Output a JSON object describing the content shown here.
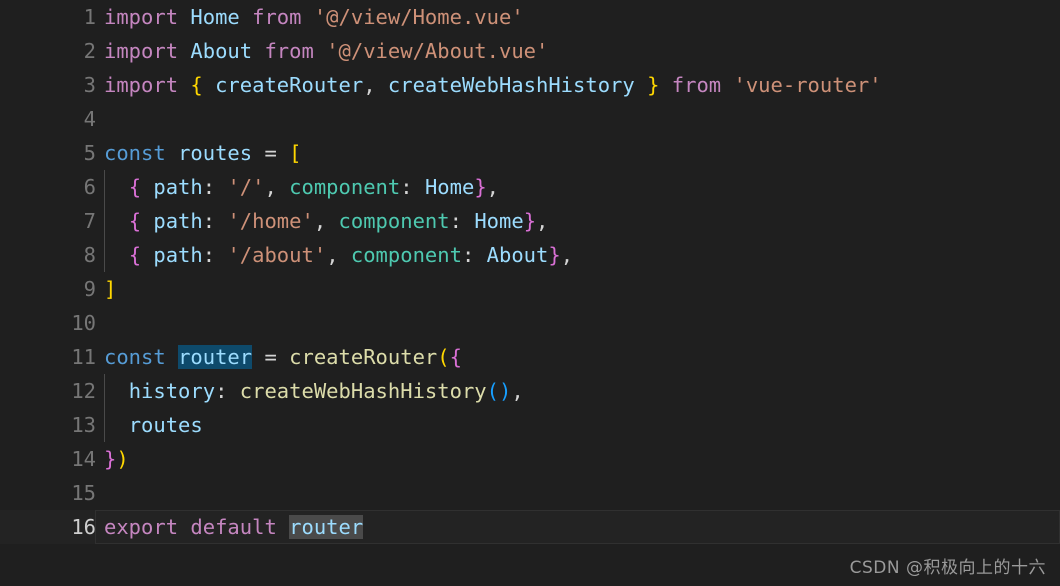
{
  "editor": {
    "background": "#1f1f1f",
    "active_line_background": "#232323",
    "selection_color": "#0e4a6b",
    "occurrence_color": "#4a4a4a",
    "gutter_color": "#767676",
    "active_gutter_color": "#cfcfcf",
    "language": "javascript",
    "active_line": 16,
    "total_lines": 16
  },
  "lines": [
    {
      "num": "1",
      "tokens": [
        {
          "t": "import",
          "c": "kw"
        },
        {
          "t": " ",
          "c": "plain"
        },
        {
          "t": "Home",
          "c": "var"
        },
        {
          "t": " ",
          "c": "plain"
        },
        {
          "t": "from",
          "c": "kw"
        },
        {
          "t": " ",
          "c": "plain"
        },
        {
          "t": "'@/view/Home.vue'",
          "c": "str"
        }
      ]
    },
    {
      "num": "2",
      "tokens": [
        {
          "t": "import",
          "c": "kw"
        },
        {
          "t": " ",
          "c": "plain"
        },
        {
          "t": "About",
          "c": "var"
        },
        {
          "t": " ",
          "c": "plain"
        },
        {
          "t": "from",
          "c": "kw"
        },
        {
          "t": " ",
          "c": "plain"
        },
        {
          "t": "'@/view/About.vue'",
          "c": "str"
        }
      ]
    },
    {
      "num": "3",
      "tokens": [
        {
          "t": "import",
          "c": "kw"
        },
        {
          "t": " ",
          "c": "plain"
        },
        {
          "t": "{",
          "c": "y"
        },
        {
          "t": " ",
          "c": "plain"
        },
        {
          "t": "createRouter",
          "c": "var"
        },
        {
          "t": ",",
          "c": "plain"
        },
        {
          "t": " ",
          "c": "plain"
        },
        {
          "t": "createWebHashHistory",
          "c": "var"
        },
        {
          "t": " ",
          "c": "plain"
        },
        {
          "t": "}",
          "c": "y"
        },
        {
          "t": " ",
          "c": "plain"
        },
        {
          "t": "from",
          "c": "kw"
        },
        {
          "t": " ",
          "c": "plain"
        },
        {
          "t": "'vue-router'",
          "c": "str"
        }
      ]
    },
    {
      "num": "4",
      "tokens": []
    },
    {
      "num": "5",
      "tokens": [
        {
          "t": "const",
          "c": "blue"
        },
        {
          "t": " ",
          "c": "plain"
        },
        {
          "t": "routes",
          "c": "var"
        },
        {
          "t": " ",
          "c": "plain"
        },
        {
          "t": "=",
          "c": "plain"
        },
        {
          "t": " ",
          "c": "plain"
        },
        {
          "t": "[",
          "c": "y"
        }
      ]
    },
    {
      "num": "6",
      "guide": true,
      "tokens": [
        {
          "t": "  ",
          "c": "plain"
        },
        {
          "t": "{",
          "c": "m"
        },
        {
          "t": " ",
          "c": "plain"
        },
        {
          "t": "path",
          "c": "var"
        },
        {
          "t": ":",
          "c": "plain"
        },
        {
          "t": " ",
          "c": "plain"
        },
        {
          "t": "'/'",
          "c": "str"
        },
        {
          "t": ",",
          "c": "plain"
        },
        {
          "t": " ",
          "c": "plain"
        },
        {
          "t": "component",
          "c": "type"
        },
        {
          "t": ":",
          "c": "plain"
        },
        {
          "t": " ",
          "c": "plain"
        },
        {
          "t": "Home",
          "c": "var"
        },
        {
          "t": "}",
          "c": "m"
        },
        {
          "t": ",",
          "c": "plain"
        }
      ]
    },
    {
      "num": "7",
      "guide": true,
      "tokens": [
        {
          "t": "  ",
          "c": "plain"
        },
        {
          "t": "{",
          "c": "m"
        },
        {
          "t": " ",
          "c": "plain"
        },
        {
          "t": "path",
          "c": "var"
        },
        {
          "t": ":",
          "c": "plain"
        },
        {
          "t": " ",
          "c": "plain"
        },
        {
          "t": "'/home'",
          "c": "str"
        },
        {
          "t": ",",
          "c": "plain"
        },
        {
          "t": " ",
          "c": "plain"
        },
        {
          "t": "component",
          "c": "type"
        },
        {
          "t": ":",
          "c": "plain"
        },
        {
          "t": " ",
          "c": "plain"
        },
        {
          "t": "Home",
          "c": "var"
        },
        {
          "t": "}",
          "c": "m"
        },
        {
          "t": ",",
          "c": "plain"
        }
      ]
    },
    {
      "num": "8",
      "guide": true,
      "tokens": [
        {
          "t": "  ",
          "c": "plain"
        },
        {
          "t": "{",
          "c": "m"
        },
        {
          "t": " ",
          "c": "plain"
        },
        {
          "t": "path",
          "c": "var"
        },
        {
          "t": ":",
          "c": "plain"
        },
        {
          "t": " ",
          "c": "plain"
        },
        {
          "t": "'/about'",
          "c": "str"
        },
        {
          "t": ",",
          "c": "plain"
        },
        {
          "t": " ",
          "c": "plain"
        },
        {
          "t": "component",
          "c": "type"
        },
        {
          "t": ":",
          "c": "plain"
        },
        {
          "t": " ",
          "c": "plain"
        },
        {
          "t": "About",
          "c": "var"
        },
        {
          "t": "}",
          "c": "m"
        },
        {
          "t": ",",
          "c": "plain"
        }
      ]
    },
    {
      "num": "9",
      "tokens": [
        {
          "t": "]",
          "c": "y"
        }
      ]
    },
    {
      "num": "10",
      "tokens": []
    },
    {
      "num": "11",
      "tokens": [
        {
          "t": "const",
          "c": "blue"
        },
        {
          "t": " ",
          "c": "plain"
        },
        {
          "t": "router",
          "c": "var",
          "sel": true
        },
        {
          "t": " ",
          "c": "plain"
        },
        {
          "t": "=",
          "c": "plain"
        },
        {
          "t": " ",
          "c": "plain"
        },
        {
          "t": "createRouter",
          "c": "fn"
        },
        {
          "t": "(",
          "c": "y"
        },
        {
          "t": "{",
          "c": "m"
        }
      ]
    },
    {
      "num": "12",
      "guide": true,
      "tokens": [
        {
          "t": "  ",
          "c": "plain"
        },
        {
          "t": "history",
          "c": "var"
        },
        {
          "t": ":",
          "c": "plain"
        },
        {
          "t": " ",
          "c": "plain"
        },
        {
          "t": "createWebHashHistory",
          "c": "fn"
        },
        {
          "t": "(",
          "c": "b"
        },
        {
          "t": ")",
          "c": "b"
        },
        {
          "t": ",",
          "c": "plain"
        }
      ]
    },
    {
      "num": "13",
      "guide": true,
      "tokens": [
        {
          "t": "  ",
          "c": "plain"
        },
        {
          "t": "routes",
          "c": "var"
        }
      ]
    },
    {
      "num": "14",
      "tokens": [
        {
          "t": "}",
          "c": "m"
        },
        {
          "t": ")",
          "c": "y"
        }
      ]
    },
    {
      "num": "15",
      "tokens": []
    },
    {
      "num": "16",
      "active": true,
      "tokens": [
        {
          "t": "export",
          "c": "kw"
        },
        {
          "t": " ",
          "c": "plain"
        },
        {
          "t": "default",
          "c": "kw"
        },
        {
          "t": " ",
          "c": "plain"
        },
        {
          "t": "router",
          "c": "var",
          "occ": true
        }
      ]
    }
  ],
  "watermark": {
    "text": "CSDN @积极向上的十六"
  }
}
